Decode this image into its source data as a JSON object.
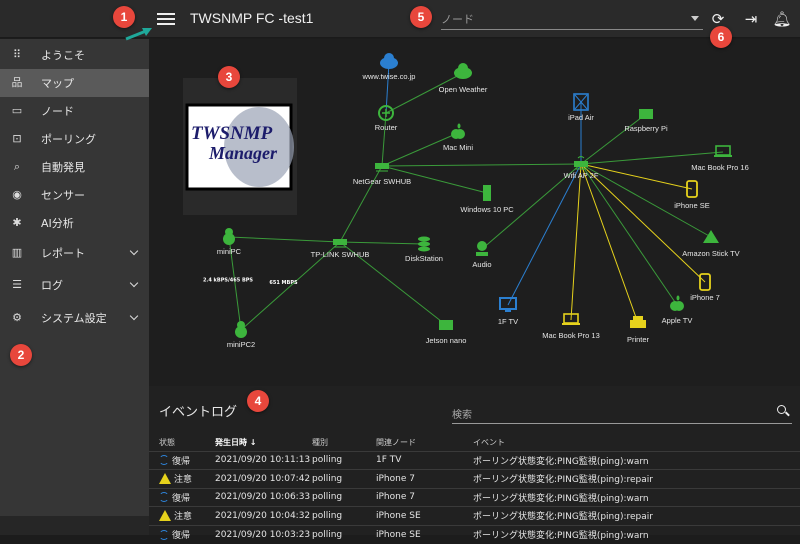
{
  "header": {
    "title": "TWSNMP FC -test1",
    "node_select_placeholder": "ノード",
    "icons": [
      "menu-icon",
      "refresh-icon",
      "logout-icon",
      "bell-icon"
    ]
  },
  "sidebar": {
    "items": [
      {
        "label": "ようこそ",
        "icon": "apps-icon",
        "active": false
      },
      {
        "label": "マップ",
        "icon": "lan-icon",
        "active": true
      },
      {
        "label": "ノード",
        "icon": "laptop-icon",
        "active": false
      },
      {
        "label": "ポーリング",
        "icon": "polling-icon",
        "active": false
      },
      {
        "label": "自動発見",
        "icon": "discover-icon",
        "active": false
      },
      {
        "label": "センサー",
        "icon": "sensor-icon",
        "active": false
      },
      {
        "label": "AI分析",
        "icon": "ai-icon",
        "active": false
      },
      {
        "label": "レポート",
        "icon": "chart-icon",
        "active": false,
        "expandable": true
      },
      {
        "label": "ログ",
        "icon": "list-icon",
        "active": false,
        "expandable": true
      },
      {
        "label": "システム設定",
        "icon": "gear-icon",
        "active": false,
        "expandable": true
      }
    ]
  },
  "map": {
    "logo_text": [
      "TWSNMP",
      "Manager"
    ],
    "colors": {
      "normal": "#3db53d",
      "info": "#2b7fd0",
      "warn": "#e6d21c",
      "line_normal": "#3a9a3a"
    },
    "nodes": [
      {
        "name": "www.twise.co.jp",
        "icon": "cloud-icon",
        "state": "info"
      },
      {
        "name": "Open Weather",
        "icon": "cloud-icon",
        "state": "normal"
      },
      {
        "name": "Router",
        "icon": "router-icon",
        "state": "normal"
      },
      {
        "name": "Mac Mini",
        "icon": "apple-icon",
        "state": "normal"
      },
      {
        "name": "NetGear SWHUB",
        "icon": "switch-icon",
        "state": "normal"
      },
      {
        "name": "Windows 10 PC",
        "icon": "desktop-icon",
        "state": "normal"
      },
      {
        "name": "iPad Air",
        "icon": "tablet-icon",
        "state": "info"
      },
      {
        "name": "Raspberry Pi",
        "icon": "board-icon",
        "state": "normal"
      },
      {
        "name": "Wifi AP 2F",
        "icon": "wifi-router-icon",
        "state": "normal"
      },
      {
        "name": "Mac Book Pro 16",
        "icon": "laptop-icon",
        "state": "normal"
      },
      {
        "name": "iPhone SE",
        "icon": "phone-icon",
        "state": "warn"
      },
      {
        "name": "Amazon  Stick TV",
        "icon": "amazon-icon",
        "state": "normal"
      },
      {
        "name": "iPhone 7",
        "icon": "phone-icon",
        "state": "warn"
      },
      {
        "name": "Apple TV",
        "icon": "apple-icon",
        "state": "normal"
      },
      {
        "name": "Printer",
        "icon": "printer-icon",
        "state": "warn"
      },
      {
        "name": "Mac Book Pro 13",
        "icon": "laptop-icon",
        "state": "warn"
      },
      {
        "name": "1F TV",
        "icon": "monitor-icon",
        "state": "info"
      },
      {
        "name": "Audio",
        "icon": "speaker-icon",
        "state": "normal"
      },
      {
        "name": "DiskStation",
        "icon": "database-icon",
        "state": "normal"
      },
      {
        "name": "TP-LINK SWHUB",
        "icon": "switch-icon",
        "state": "normal"
      },
      {
        "name": "miniPC",
        "icon": "linux-icon",
        "state": "normal"
      },
      {
        "name": "miniPC2",
        "icon": "linux-icon",
        "state": "normal"
      },
      {
        "name": "Jetson nano",
        "icon": "board-icon",
        "state": "normal"
      }
    ],
    "lines": [
      {
        "from": "www.twise.co.jp",
        "to": "Router",
        "state": "info"
      },
      {
        "from": "Open Weather",
        "to": "Router",
        "state": "normal"
      },
      {
        "from": "Router",
        "to": "NetGear SWHUB",
        "state": "normal"
      },
      {
        "from": "Mac Mini",
        "to": "NetGear SWHUB",
        "state": "normal"
      },
      {
        "from": "NetGear SWHUB",
        "to": "Windows 10 PC",
        "state": "normal"
      },
      {
        "from": "NetGear SWHUB",
        "to": "Wifi AP 2F",
        "state": "normal"
      },
      {
        "from": "NetGear SWHUB",
        "to": "TP-LINK SWHUB",
        "state": "normal"
      },
      {
        "from": "iPad Air",
        "to": "Wifi AP 2F",
        "state": "info"
      },
      {
        "from": "Raspberry Pi",
        "to": "Wifi AP 2F",
        "state": "normal"
      },
      {
        "from": "Wifi AP 2F",
        "to": "Mac Book Pro 16",
        "state": "normal"
      },
      {
        "from": "Wifi AP 2F",
        "to": "iPhone SE",
        "state": "warn"
      },
      {
        "from": "Wifi AP 2F",
        "to": "Amazon  Stick TV",
        "state": "normal"
      },
      {
        "from": "Wifi AP 2F",
        "to": "iPhone 7",
        "state": "warn"
      },
      {
        "from": "Wifi AP 2F",
        "to": "Apple TV",
        "state": "normal"
      },
      {
        "from": "Wifi AP 2F",
        "to": "Printer",
        "state": "warn"
      },
      {
        "from": "Wifi AP 2F",
        "to": "Mac Book Pro 13",
        "state": "warn"
      },
      {
        "from": "Wifi AP 2F",
        "to": "1F TV",
        "state": "info"
      },
      {
        "from": "Wifi AP 2F",
        "to": "Audio",
        "state": "normal"
      },
      {
        "from": "TP-LINK SWHUB",
        "to": "DiskStation",
        "state": "normal"
      },
      {
        "from": "TP-LINK SWHUB",
        "to": "miniPC",
        "state": "normal"
      },
      {
        "from": "TP-LINK SWHUB",
        "to": "miniPC2",
        "state": "normal",
        "label": "651 MBPS"
      },
      {
        "from": "TP-LINK SWHUB",
        "to": "Jetson nano",
        "state": "normal"
      },
      {
        "from": "miniPC",
        "to": "miniPC2",
        "state": "normal",
        "label": "2.4 kBPS/465 BPS"
      }
    ]
  },
  "event_log": {
    "title": "イベントログ",
    "search_placeholder": "検索",
    "columns": [
      "状態",
      "発生日時",
      "種別",
      "関連ノード",
      "イベント"
    ],
    "sort_indicator": "↓",
    "rows": [
      {
        "state": "復帰",
        "state_icon": "sync-icon",
        "time": "2021/09/20 10:11:13",
        "type": "polling",
        "node": "1F TV",
        "event": "ポーリング状態変化:PING監視(ping):warn"
      },
      {
        "state": "注意",
        "state_icon": "warning-icon",
        "time": "2021/09/20 10:07:42",
        "type": "polling",
        "node": "iPhone 7",
        "event": "ポーリング状態変化:PING監視(ping):repair"
      },
      {
        "state": "復帰",
        "state_icon": "sync-icon",
        "time": "2021/09/20 10:06:33",
        "type": "polling",
        "node": "iPhone 7",
        "event": "ポーリング状態変化:PING監視(ping):warn"
      },
      {
        "state": "注意",
        "state_icon": "warning-icon",
        "time": "2021/09/20 10:04:32",
        "type": "polling",
        "node": "iPhone SE",
        "event": "ポーリング状態変化:PING監視(ping):repair"
      },
      {
        "state": "復帰",
        "state_icon": "sync-icon",
        "time": "2021/09/20 10:03:23",
        "type": "polling",
        "node": "iPhone SE",
        "event": "ポーリング状態変化:PING監視(ping):warn"
      }
    ]
  },
  "callouts": [
    "1",
    "2",
    "3",
    "4",
    "5",
    "6"
  ]
}
